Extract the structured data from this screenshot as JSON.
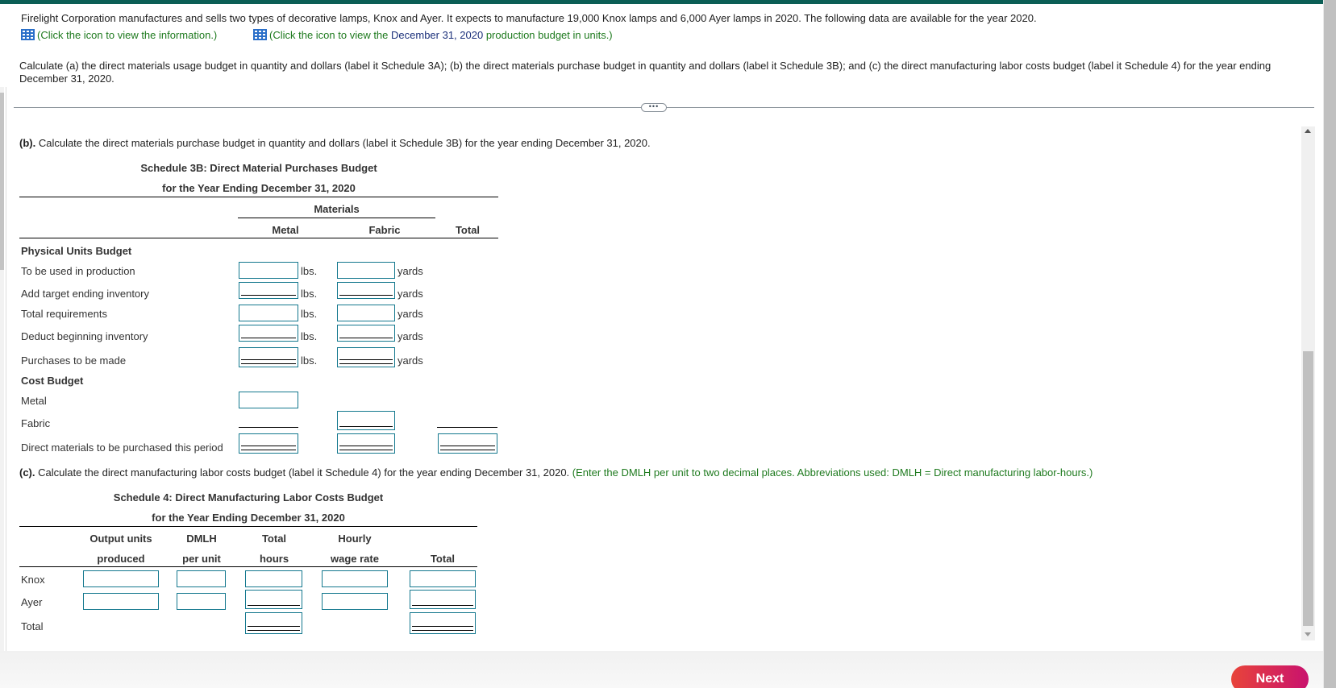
{
  "intro": {
    "text": "Firelight Corporation manufactures and sells two types of decorative lamps, Knox and Ayer. It expects to manufacture 19,000 Knox lamps and 6,000 Ayer lamps in 2020. The following data are available for the year 2020.",
    "link1": "(Click the icon to view the information.)",
    "link2_prefix": "(Click the icon to view the ",
    "link2_highlight": "December 31, 2020",
    "link2_suffix": " production budget in units.)",
    "instructions_line1": "Calculate (a) the direct materials usage budget in quantity and dollars (label it Schedule 3A); (b) the direct materials purchase budget in quantity and dollars (label it Schedule 3B); and (c) the direct manufacturing labor costs budget (label it Schedule 4) for the year ending",
    "instructions_line2": "December 31, 2020."
  },
  "divider_handle": "•••",
  "part_b": {
    "prefix": "(b).",
    "text": " Calculate the direct materials purchase budget in quantity and dollars (label it Schedule 3B) for the year ending December 31, 2020.",
    "title": "Schedule 3B: Direct Material Purchases Budget",
    "subtitle": "for the Year Ending December 31, 2020",
    "group_header": "Materials",
    "columns": [
      "Metal",
      "Fabric",
      "Total"
    ],
    "physical_header": "Physical Units Budget",
    "physical_rows": [
      {
        "label": "To be used in production",
        "metal": "",
        "fabric": "",
        "metal_unit": "lbs.",
        "fabric_unit": "yards"
      },
      {
        "label": "Add target ending inventory",
        "metal": "",
        "fabric": "",
        "metal_unit": "lbs.",
        "fabric_unit": "yards"
      },
      {
        "label": "Total requirements",
        "metal": "",
        "fabric": "",
        "metal_unit": "lbs.",
        "fabric_unit": "yards"
      },
      {
        "label": "Deduct beginning inventory",
        "metal": "",
        "fabric": "",
        "metal_unit": "lbs.",
        "fabric_unit": "yards"
      },
      {
        "label": "Purchases to be made",
        "metal": "",
        "fabric": "",
        "metal_unit": "lbs.",
        "fabric_unit": "yards"
      }
    ],
    "cost_header": "Cost Budget",
    "cost_rows": [
      {
        "label": "Metal",
        "metal": "",
        "fabric": "",
        "total": ""
      },
      {
        "label": "Fabric",
        "metal": "",
        "fabric": "",
        "total": ""
      },
      {
        "label": "Direct materials to be purchased this period",
        "metal": "",
        "fabric": "",
        "total": ""
      }
    ]
  },
  "part_c": {
    "prefix": "(c).",
    "text": " Calculate the direct manufacturing labor costs budget (label it Schedule 4) for the year ending December 31, 2020. ",
    "hint": "(Enter the DMLH per unit to two decimal places. Abbreviations used: DMLH = Direct manufacturing labor-hours.)",
    "title": "Schedule 4: Direct Manufacturing Labor Costs Budget",
    "subtitle": "for the Year Ending December 31, 2020",
    "columns": [
      {
        "line1": "Output units",
        "line2": "produced"
      },
      {
        "line1": "DMLH",
        "line2": "per unit"
      },
      {
        "line1": "Total",
        "line2": "hours"
      },
      {
        "line1": "Hourly",
        "line2": "wage rate"
      },
      {
        "line1": "",
        "line2": "Total"
      }
    ],
    "rows": [
      {
        "label": "Knox",
        "output_units": "",
        "dmlh_per_unit": "",
        "total_hours": "",
        "hourly_wage_rate": "",
        "total": ""
      },
      {
        "label": "Ayer",
        "output_units": "",
        "dmlh_per_unit": "",
        "total_hours": "",
        "hourly_wage_rate": "",
        "total": ""
      },
      {
        "label": "Total",
        "total_hours": "",
        "total": ""
      }
    ]
  },
  "footer": {
    "next_label": "Next"
  },
  "colors": {
    "top_bar": "#0b5e55",
    "input_border": "#14788e",
    "hint_green": "#1e7a1e",
    "next_gradient_start": "#e8443a",
    "next_gradient_end": "#c9126e"
  }
}
